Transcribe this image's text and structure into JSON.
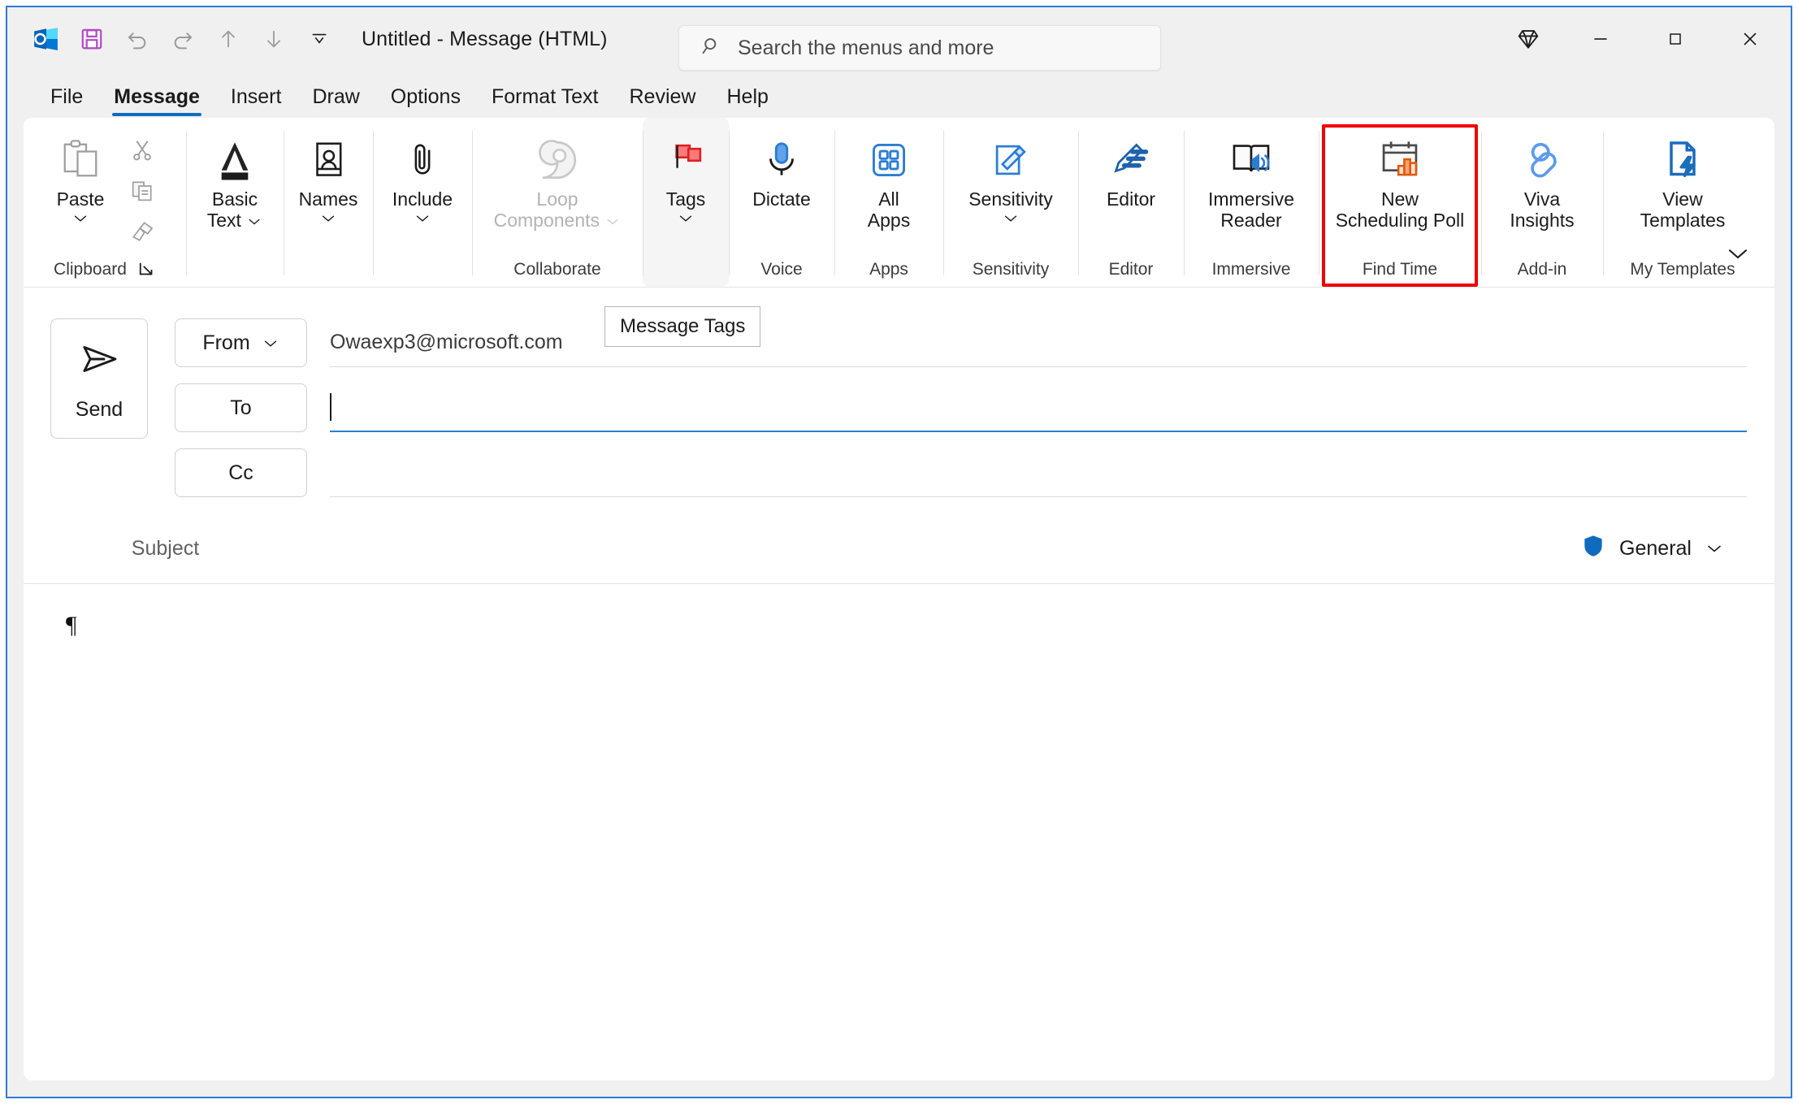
{
  "window": {
    "title": "Untitled  -  Message (HTML)",
    "accent_border": "#2b7cd3"
  },
  "quick_access": {
    "items": [
      {
        "name": "outlook-app-icon",
        "label": "Outlook"
      },
      {
        "name": "save-icon",
        "label": "Save"
      },
      {
        "name": "undo-icon",
        "label": "Undo"
      },
      {
        "name": "redo-icon",
        "label": "Redo"
      },
      {
        "name": "previous-item-icon",
        "label": "Previous Item"
      },
      {
        "name": "next-item-icon",
        "label": "Next Item"
      },
      {
        "name": "customize-quick-access-toolbar-icon",
        "label": "Customize Quick Access Toolbar"
      }
    ]
  },
  "search": {
    "placeholder": "Search the menus and more",
    "icon": "search-icon"
  },
  "window_controls": {
    "diamond_label": "Diamond",
    "minimize_label": "Minimize",
    "maximize_label": "Maximize",
    "close_label": "Close"
  },
  "tabs": [
    {
      "label": "File",
      "active": false
    },
    {
      "label": "Message",
      "active": true
    },
    {
      "label": "Insert",
      "active": false
    },
    {
      "label": "Draw",
      "active": false
    },
    {
      "label": "Options",
      "active": false
    },
    {
      "label": "Format Text",
      "active": false
    },
    {
      "label": "Review",
      "active": false
    },
    {
      "label": "Help",
      "active": false
    }
  ],
  "ribbon": {
    "groups": {
      "clipboard": {
        "label": "Clipboard",
        "paste": "Paste",
        "cut": "Cut",
        "copy": "Copy",
        "format_painter": "Format Painter"
      },
      "basic_text": {
        "line1": "Basic",
        "line2": "Text"
      },
      "names": {
        "label": "Names"
      },
      "include": {
        "label": "Include"
      },
      "collaborate": {
        "label": "Collaborate",
        "loop_line1": "Loop",
        "loop_line2": "Components",
        "disabled": true
      },
      "tags": {
        "label": "Tags",
        "hovered": true
      },
      "voice": {
        "label": "Voice",
        "dictate": "Dictate"
      },
      "apps": {
        "label": "Apps",
        "all_line1": "All",
        "all_line2": "Apps"
      },
      "sensitivity": {
        "label": "Sensitivity",
        "button": "Sensitivity"
      },
      "editor": {
        "label": "Editor",
        "button": "Editor"
      },
      "immersive": {
        "label": "Immersive",
        "line1": "Immersive",
        "line2": "Reader"
      },
      "find_time": {
        "label": "Find Time",
        "line1": "New",
        "line2": "Scheduling Poll",
        "highlighted": true,
        "highlight_color": "#ee0000"
      },
      "add_in": {
        "label": "Add-in",
        "line1": "Viva",
        "line2": "Insights"
      },
      "my_templates": {
        "label": "My Templates",
        "line1": "View",
        "line2": "Templates"
      }
    },
    "collapse_label": "Collapse the Ribbon"
  },
  "tooltip": {
    "text": "Message Tags"
  },
  "compose": {
    "send_button": "Send",
    "from_label": "From",
    "from_value": "Owaexp3@microsoft.com",
    "to_label": "To",
    "to_value": "",
    "cc_label": "Cc",
    "cc_value": "",
    "subject_label": "Subject",
    "subject_value": "",
    "sensitivity_badge": "General",
    "body_text": "¶"
  }
}
